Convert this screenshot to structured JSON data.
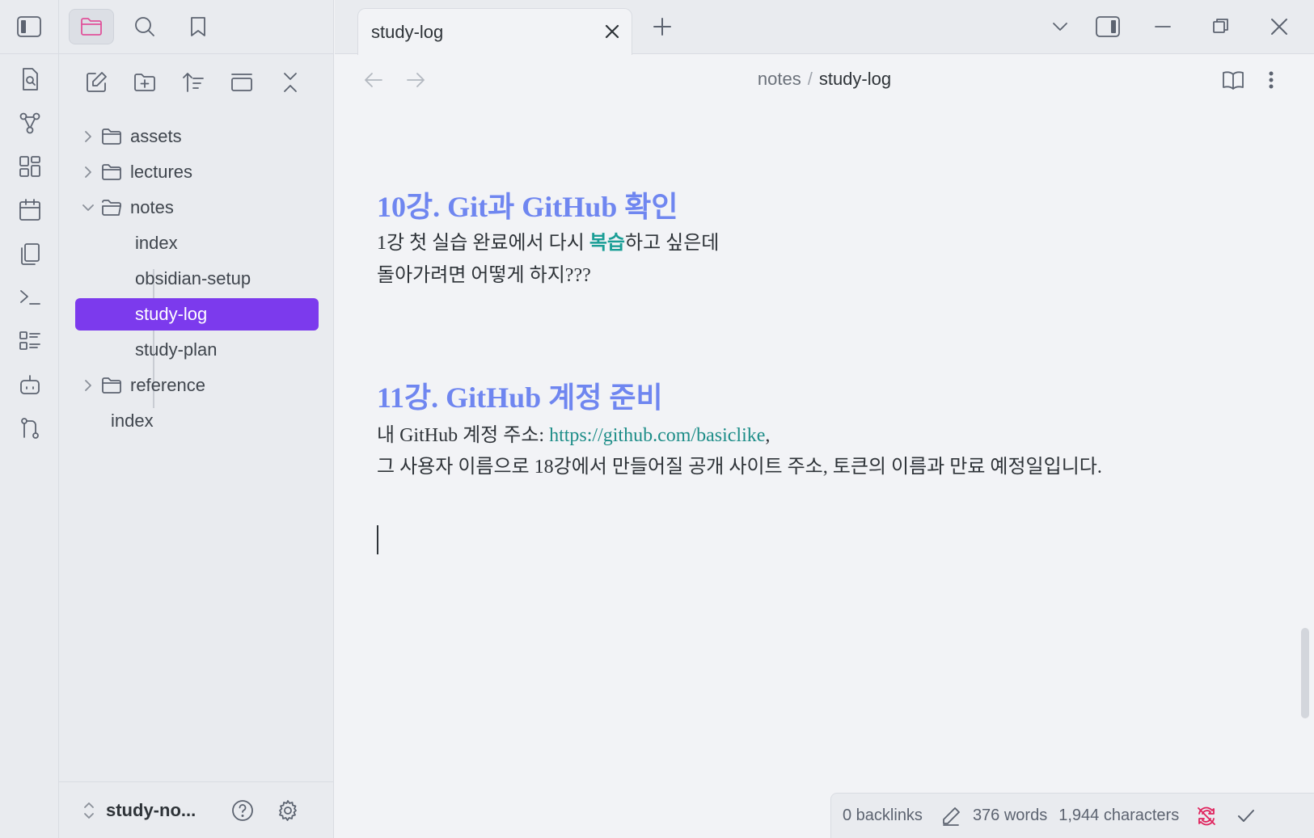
{
  "ribbon": {
    "toggle_icon": "sidebar-left-icon",
    "items": [
      {
        "name": "quick-switcher-icon"
      },
      {
        "name": "graph-view-icon"
      },
      {
        "name": "canvas-icon"
      },
      {
        "name": "daily-note-icon"
      },
      {
        "name": "templates-icon"
      },
      {
        "name": "command-palette-icon"
      },
      {
        "name": "outline-icon"
      },
      {
        "name": "copilot-icon"
      },
      {
        "name": "git-icon"
      }
    ]
  },
  "sidebar": {
    "tabs": [
      "files",
      "search",
      "bookmarks"
    ],
    "tree": [
      {
        "type": "folder",
        "label": "assets",
        "expanded": false
      },
      {
        "type": "folder",
        "label": "lectures",
        "expanded": false
      },
      {
        "type": "folder",
        "label": "notes",
        "expanded": true
      },
      {
        "type": "file",
        "label": "index"
      },
      {
        "type": "file",
        "label": "obsidian-setup"
      },
      {
        "type": "file",
        "label": "study-log",
        "active": true
      },
      {
        "type": "file",
        "label": "study-plan"
      },
      {
        "type": "folder",
        "label": "reference",
        "expanded": false
      },
      {
        "type": "file",
        "label": "index",
        "root": true
      }
    ],
    "vault_name": "study-no..."
  },
  "tabs": {
    "active": "study-log"
  },
  "breadcrumb": {
    "folder": "notes",
    "separator": "/",
    "file": "study-log"
  },
  "editor": {
    "heading1": "10강. Git과 GitHub 확인",
    "line1_pre": "1강 첫 실습 완료에서 다시 ",
    "line1_highlight": "복습",
    "line1_post": "하고 싶은데",
    "line2": "돌아가려면 어떻게 하지???",
    "heading2": "11강. GitHub 계정 준비",
    "line3_pre": "내 GitHub 계정 주소: ",
    "line3_link": "https://github.com/basiclike",
    "line3_post": ",",
    "line4": "그 사용자 이름으로 18강에서 만들어질 공개 사이트 주소, 토큰의 이름과 만료 예정일입니다."
  },
  "status": {
    "backlinks": "0 backlinks",
    "words": "376 words",
    "characters": "1,944 characters"
  },
  "colors": {
    "accent": "#7c3aed",
    "heading": "#6f86f0",
    "highlight": "#1a9e96",
    "sync_error": "#e0245e"
  }
}
